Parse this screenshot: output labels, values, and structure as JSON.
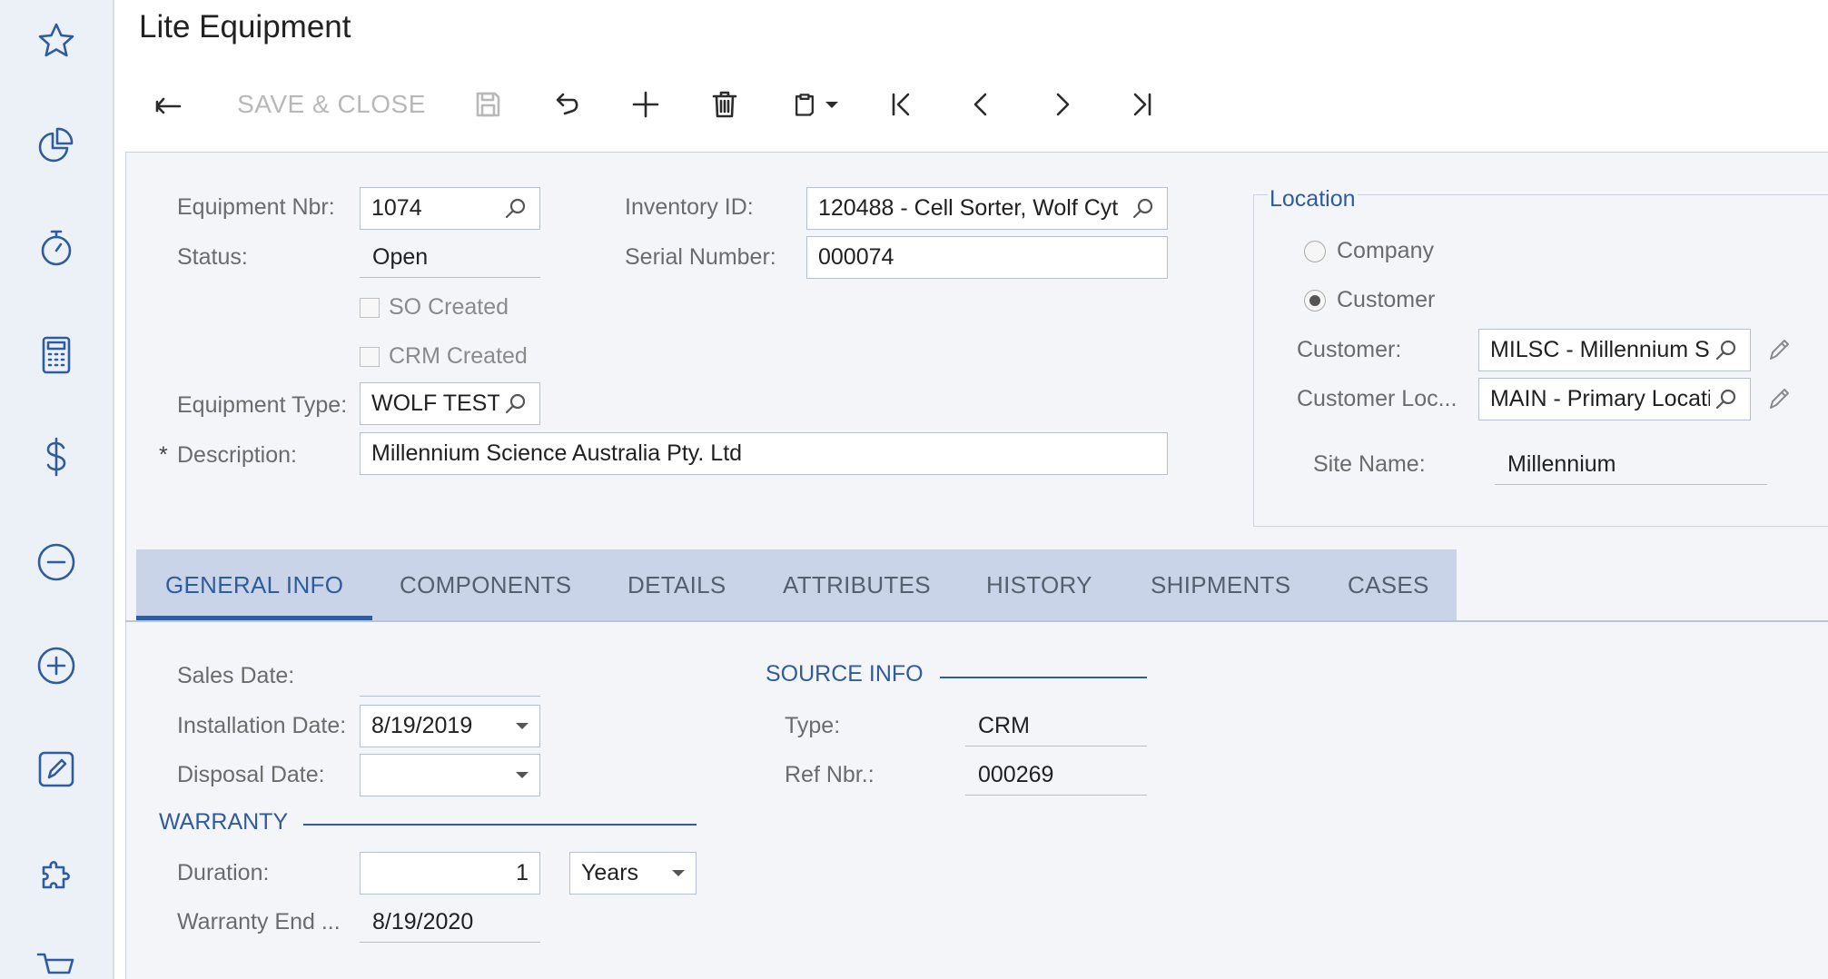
{
  "page_title": "Lite Equipment",
  "toolbar": {
    "save_close_label": "SAVE & CLOSE"
  },
  "form": {
    "equipment_nbr": {
      "label": "Equipment Nbr:",
      "value": "1074"
    },
    "status": {
      "label": "Status:",
      "value": "Open"
    },
    "so_created": {
      "label": "SO Created",
      "checked": false
    },
    "crm_created": {
      "label": "CRM Created",
      "checked": false
    },
    "equipment_type": {
      "label": "Equipment Type:",
      "value": "WOLF TEST"
    },
    "description": {
      "required_mark": "*",
      "label": "Description:",
      "value": "Millennium Science Australia Pty. Ltd"
    },
    "inventory_id": {
      "label": "Inventory ID:",
      "value": "120488 - Cell Sorter, Wolf Cyt"
    },
    "serial_number": {
      "label": "Serial Number:",
      "value": "000074"
    }
  },
  "location": {
    "title": "Location",
    "options": [
      {
        "label": "Company",
        "selected": false
      },
      {
        "label": "Customer",
        "selected": true
      }
    ],
    "customer": {
      "label": "Customer:",
      "value": "MILSC - Millennium Science"
    },
    "customer_location": {
      "label": "Customer Loc...",
      "value": "MAIN - Primary Location"
    },
    "site_name": {
      "label": "Site Name:",
      "value": "Millennium"
    }
  },
  "tabs": [
    {
      "label": "GENERAL INFO",
      "active": true
    },
    {
      "label": "COMPONENTS",
      "active": false
    },
    {
      "label": "DETAILS",
      "active": false
    },
    {
      "label": "ATTRIBUTES",
      "active": false
    },
    {
      "label": "HISTORY",
      "active": false
    },
    {
      "label": "SHIPMENTS",
      "active": false
    },
    {
      "label": "CASES",
      "active": false
    }
  ],
  "general": {
    "sales_date": {
      "label": "Sales Date:",
      "value": ""
    },
    "installation_date": {
      "label": "Installation Date:",
      "value": "8/19/2019"
    },
    "disposal_date": {
      "label": "Disposal Date:",
      "value": ""
    },
    "warranty": {
      "title": "WARRANTY",
      "duration": {
        "label": "Duration:",
        "value": "1",
        "unit": "Years"
      },
      "end": {
        "label": "Warranty End ...",
        "value": "8/19/2020"
      }
    },
    "source_info": {
      "title": "SOURCE INFO",
      "type": {
        "label": "Type:",
        "value": "CRM"
      },
      "ref_nbr": {
        "label": "Ref Nbr.:",
        "value": "000269"
      }
    }
  },
  "colors": {
    "accent": "#2f5c9e",
    "tabbar": "#c9d4e8",
    "form_bg": "#f3f5f9",
    "rail_bg": "#ecf1f8"
  },
  "icons": {
    "rail": [
      "star-icon",
      "pie-chart-icon",
      "stopwatch-icon",
      "calculator-icon",
      "dollar-icon",
      "minus-circle-icon",
      "plus-circle-icon",
      "edit-icon",
      "puzzle-icon",
      "cart-icon"
    ],
    "toolbar": [
      "back-arrow-icon",
      "save-icon",
      "undo-icon",
      "plus-icon",
      "trash-icon",
      "clipboard-icon",
      "first-record-icon",
      "prev-record-icon",
      "next-record-icon",
      "last-record-icon"
    ]
  }
}
